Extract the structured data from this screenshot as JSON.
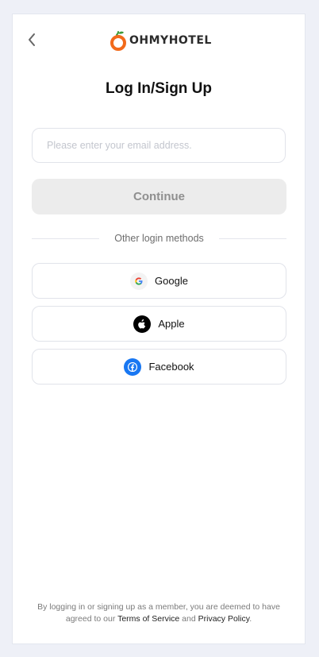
{
  "header": {
    "logo_text": "OHMYHOTEL",
    "back_icon": "chevron-left-icon",
    "logo_icon": "orange-fruit-icon"
  },
  "title": "Log In/Sign Up",
  "email": {
    "placeholder": "Please enter your email address.",
    "value": ""
  },
  "continue_label": "Continue",
  "divider_label": "Other login methods",
  "social": [
    {
      "label": "Google",
      "icon": "google-icon"
    },
    {
      "label": "Apple",
      "icon": "apple-icon"
    },
    {
      "label": "Facebook",
      "icon": "facebook-icon"
    }
  ],
  "footer": {
    "prefix": "By logging in or signing up as a member, you are deemed to have agreed to our",
    "terms_link": "Terms of Service",
    "and": "and",
    "privacy_link": "Privacy Policy",
    "suffix": "."
  },
  "colors": {
    "background": "#eef0f7",
    "card": "#ffffff",
    "brand_orange": "#f26a1b",
    "brand_green": "#3d9a3a",
    "continue_disabled_bg": "#ececec",
    "continue_disabled_text": "#8f8f8f",
    "facebook_blue": "#1877f2"
  }
}
